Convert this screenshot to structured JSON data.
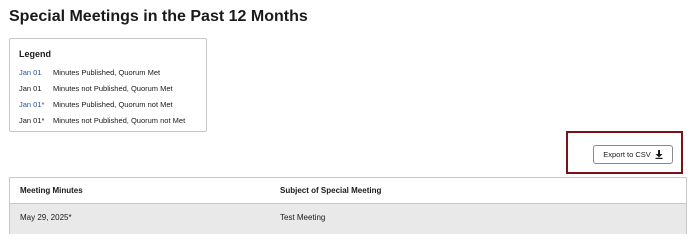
{
  "page": {
    "title": "Special Meetings in the Past 12 Months"
  },
  "legend": {
    "title": "Legend",
    "items": [
      {
        "date": "Jan 01",
        "description": "Minutes Published, Quorum Met",
        "color": "#2a4f9a"
      },
      {
        "date": "Jan 01",
        "description": "Minutes not Published, Quorum Met",
        "color": "#1a1a1a"
      },
      {
        "date": "Jan 01*",
        "description": "Minutes Published, Quorum not Met",
        "color": "#2a4f9a"
      },
      {
        "date": "Jan 01*",
        "description": "Minutes not Published, Quorum not Met",
        "color": "#1a1a1a"
      }
    ]
  },
  "toolbar": {
    "export_label": "Export to CSV",
    "export_icon": "download-icon",
    "highlight_color": "#7a1218"
  },
  "table": {
    "columns": [
      "Meeting Minutes",
      "Subject of Special Meeting"
    ],
    "rows": [
      {
        "date": "May 29, 2025*",
        "subject": "Test Meeting"
      }
    ]
  }
}
